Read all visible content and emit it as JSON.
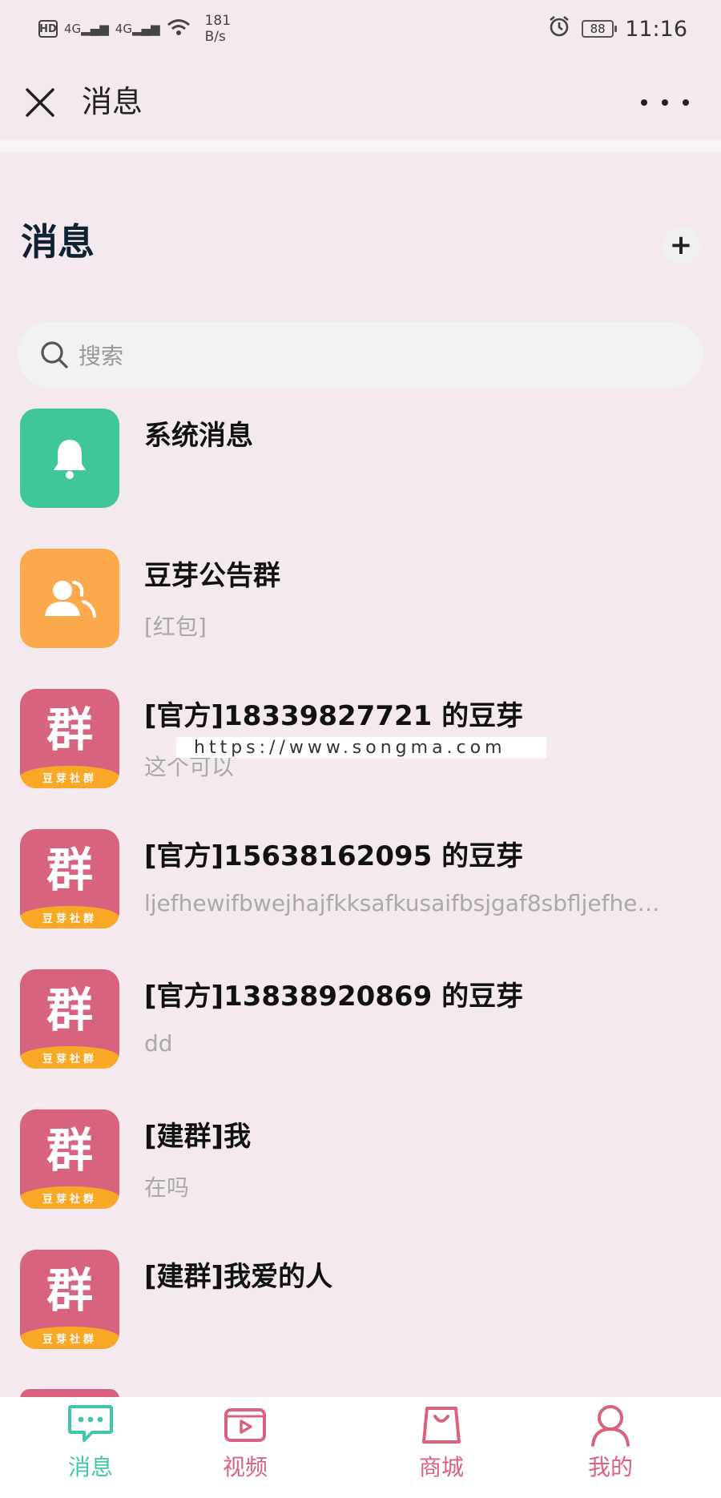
{
  "status_bar": {
    "hd": "HD",
    "signal1": "4G",
    "signal2": "4G",
    "speed_value": "181",
    "speed_unit": "B/s",
    "battery": "88",
    "time": "11:16"
  },
  "nav": {
    "title": "消息"
  },
  "header": {
    "title": "消息",
    "add_label": "+"
  },
  "search": {
    "placeholder": "搜索"
  },
  "conversations": [
    {
      "title": "系统消息",
      "subtitle": "",
      "avatar": "bell-icon",
      "avatar_color": "#3fc79a"
    },
    {
      "title": "豆芽公告群",
      "subtitle": "[红包]",
      "avatar": "people-icon",
      "avatar_color": "#fca94e"
    },
    {
      "title": "[官方]18339827721 的豆芽",
      "subtitle": "这个可以",
      "avatar_text": "群",
      "avatar_band": "豆芽社群",
      "avatar_color": "#d8637f"
    },
    {
      "title": "[官方]15638162095 的豆芽",
      "subtitle": "ljefhewifbwejhajfkksafkusaifbsjgaf8sbfljefhewif…",
      "avatar_text": "群",
      "avatar_band": "豆芽社群",
      "avatar_color": "#d8637f"
    },
    {
      "title": "[官方]13838920869 的豆芽",
      "subtitle": "dd",
      "avatar_text": "群",
      "avatar_band": "豆芽社群",
      "avatar_color": "#d8637f"
    },
    {
      "title": "[建群]我",
      "subtitle": "在吗",
      "avatar_text": "群",
      "avatar_band": "豆芽社群",
      "avatar_color": "#d8637f"
    },
    {
      "title": "[建群]我爱的人",
      "subtitle": "",
      "avatar_text": "群",
      "avatar_band": "豆芽社群",
      "avatar_color": "#d8637f"
    }
  ],
  "watermark": "https://www.songma.com",
  "tabs": [
    {
      "label": "消息",
      "icon": "chat-icon",
      "color": "#3fc7a9",
      "active": true
    },
    {
      "label": "视频",
      "icon": "video-icon",
      "color": "#d8637f",
      "active": false
    },
    {
      "label": "商城",
      "icon": "shopping-bag-icon",
      "color": "#d8637f",
      "active": false
    },
    {
      "label": "我的",
      "icon": "user-icon",
      "color": "#d8637f",
      "active": false
    }
  ]
}
